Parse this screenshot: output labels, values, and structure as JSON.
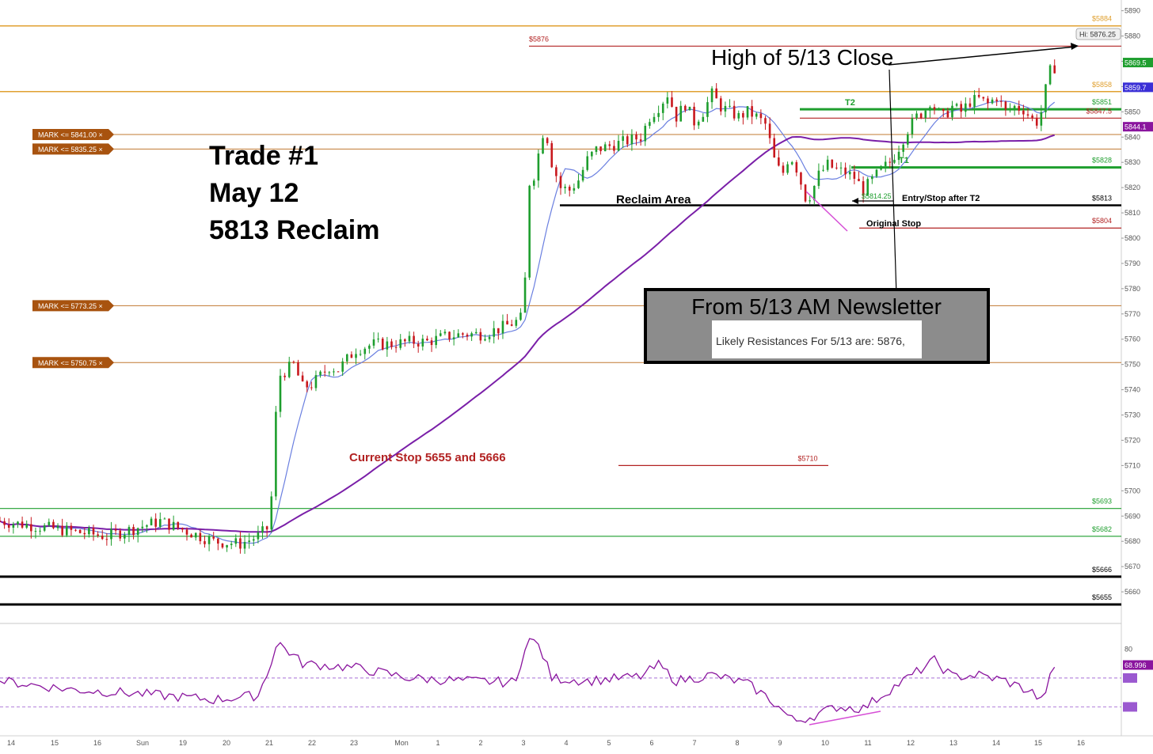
{
  "chart_data": {
    "type": "candlestick",
    "annotations": {
      "title_lines": [
        "Trade #1",
        "May 12",
        "5813 Reclaim"
      ],
      "high_close": "High of 5/13 Close",
      "newsletter_title": "From 5/13 AM Newsletter",
      "newsletter_text": "Likely Resistances For 5/13 are: 5876,",
      "reclaim_area": "Reclaim Area",
      "entry_stop": "Entry/Stop after T2",
      "original_stop": "Original Stop",
      "current_stop": "Current Stop 5655 and 5666",
      "t1": "T1",
      "t2": "T2",
      "low_marker": "$5814.25",
      "high_marker": "Hi: 5876.25"
    },
    "y_axis": {
      "ticks": [
        5890,
        5880,
        5870,
        5860,
        5850,
        5840,
        5830,
        5820,
        5810,
        5800,
        5790,
        5780,
        5770,
        5760,
        5750,
        5740,
        5730,
        5720,
        5710,
        5700,
        5690,
        5680,
        5670,
        5660
      ],
      "range": [
        5650,
        5893
      ]
    },
    "x_axis": {
      "ticks": [
        "14",
        "15",
        "16",
        "Sun",
        "19",
        "20",
        "21",
        "22",
        "23",
        "Mon",
        "1",
        "2",
        "3",
        "4",
        "5",
        "6",
        "7",
        "8",
        "9",
        "10",
        "11",
        "12",
        "13",
        "14",
        "15",
        "16"
      ]
    },
    "price_badges": [
      {
        "label": "5869.5",
        "value": 5869.5,
        "color": "#1e9e2e"
      },
      {
        "label": "5859.7",
        "value": 5859.7,
        "color": "#3a2fd6"
      },
      {
        "label": "5844.1",
        "value": 5844.1,
        "color": "#8a159e"
      }
    ],
    "levels": [
      {
        "value": 5884,
        "label": "$5884",
        "color": "#e0a030"
      },
      {
        "value": 5876,
        "label": "$5876",
        "color": "#b22222"
      },
      {
        "value": 5858,
        "label": "$5858",
        "color": "#e0a030"
      },
      {
        "value": 5851,
        "label": "$5851",
        "color": "#1e9e2e"
      },
      {
        "value": 5847.5,
        "label": "$5847.5",
        "color": "#b22222"
      },
      {
        "value": 5828,
        "label": "$5828",
        "color": "#1e9e2e"
      },
      {
        "value": 5813,
        "label": "$5813",
        "color": "#000000"
      },
      {
        "value": 5804,
        "label": "$5804",
        "color": "#b22222"
      },
      {
        "value": 5710,
        "label": "$5710",
        "color": "#b22222"
      },
      {
        "value": 5693,
        "label": "$5693",
        "color": "#1e9e2e"
      },
      {
        "value": 5682,
        "label": "$5682",
        "color": "#1e9e2e"
      },
      {
        "value": 5666,
        "label": "$5666",
        "color": "#000000"
      },
      {
        "value": 5655,
        "label": "$5655",
        "color": "#000000"
      }
    ],
    "marks": [
      {
        "label": "MARK <= 5841.00",
        "value": 5841.0
      },
      {
        "label": "MARK <= 5835.25",
        "value": 5835.25
      },
      {
        "label": "MARK <= 5773.25",
        "value": 5773.25
      },
      {
        "label": "MARK <= 5750.75",
        "value": 5750.75
      }
    ],
    "close_path": [
      [
        0,
        5688
      ],
      [
        3,
        5685
      ],
      [
        6,
        5682
      ],
      [
        9,
        5688
      ],
      [
        12,
        5680
      ],
      [
        13.5,
        5679
      ],
      [
        14.5,
        5682
      ],
      [
        15,
        5685
      ],
      [
        15.3,
        5700
      ],
      [
        15.6,
        5745
      ],
      [
        16.5,
        5750
      ],
      [
        17,
        5741
      ],
      [
        17.5,
        5742
      ],
      [
        18.5,
        5749
      ],
      [
        19,
        5748
      ],
      [
        19.5,
        5752
      ],
      [
        20,
        5756
      ],
      [
        21,
        5758
      ],
      [
        22,
        5758
      ],
      [
        23,
        5759
      ],
      [
        24,
        5759
      ],
      [
        25,
        5761
      ],
      [
        26,
        5762
      ],
      [
        27,
        5762
      ],
      [
        28,
        5764
      ],
      [
        29,
        5767
      ],
      [
        29.4,
        5769
      ],
      [
        29.6,
        5798
      ],
      [
        29.8,
        5830
      ],
      [
        30,
        5825
      ],
      [
        30.3,
        5835
      ],
      [
        30.6,
        5845
      ],
      [
        31,
        5830
      ],
      [
        31.5,
        5820
      ],
      [
        32,
        5819
      ],
      [
        32.5,
        5823
      ],
      [
        33,
        5831
      ],
      [
        33.5,
        5835
      ],
      [
        34,
        5836
      ],
      [
        35,
        5838
      ],
      [
        36,
        5840
      ],
      [
        36.5,
        5848
      ],
      [
        37,
        5852
      ],
      [
        37.5,
        5857
      ],
      [
        38,
        5848
      ],
      [
        38.5,
        5853
      ],
      [
        39,
        5846
      ],
      [
        39.5,
        5850
      ],
      [
        40,
        5857
      ],
      [
        40.5,
        5852
      ],
      [
        41,
        5850
      ],
      [
        41.5,
        5848
      ],
      [
        42,
        5850
      ],
      [
        42.5,
        5848
      ],
      [
        43,
        5845
      ],
      [
        43.3,
        5837
      ],
      [
        43.6,
        5828
      ],
      [
        44,
        5826
      ],
      [
        44.3,
        5832
      ],
      [
        44.6,
        5831
      ],
      [
        45,
        5822
      ],
      [
        45.3,
        5815
      ],
      [
        45.6,
        5818
      ],
      [
        46,
        5825
      ],
      [
        46.5,
        5829
      ],
      [
        47,
        5827
      ],
      [
        47.5,
        5826
      ],
      [
        48,
        5824
      ],
      [
        48.5,
        5819
      ],
      [
        49,
        5823
      ],
      [
        49.5,
        5827
      ],
      [
        50,
        5830
      ],
      [
        50.5,
        5836
      ],
      [
        51,
        5843
      ],
      [
        51.5,
        5848
      ],
      [
        52,
        5851
      ],
      [
        52.3,
        5855
      ],
      [
        52.6,
        5850
      ],
      [
        53,
        5848
      ],
      [
        53.5,
        5852
      ],
      [
        54,
        5850
      ],
      [
        54.5,
        5854
      ],
      [
        55,
        5855
      ],
      [
        55.5,
        5853
      ],
      [
        56,
        5856
      ],
      [
        56.5,
        5850
      ],
      [
        57,
        5852
      ],
      [
        57.5,
        5851
      ],
      [
        58,
        5847
      ],
      [
        58.3,
        5846
      ],
      [
        58.6,
        5852
      ],
      [
        58.8,
        5861
      ],
      [
        59,
        5866
      ],
      [
        59.3,
        5868
      ]
    ],
    "x_range": [
      0,
      63
    ]
  }
}
